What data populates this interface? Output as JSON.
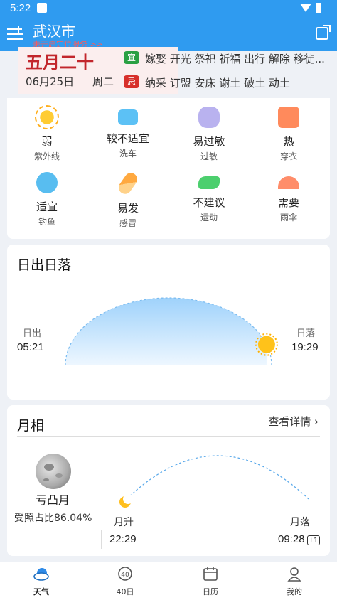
{
  "status": {
    "time": "5:22"
  },
  "header": {
    "city": "武汉市",
    "subtitle": "未开启定位服务 >>"
  },
  "almanac": {
    "lunar_date": "五月二十",
    "solar_date": "06月25日",
    "weekday": "周二",
    "yi_tag": "宜",
    "yi_text": "嫁娶 开光 祭祀 祈福 出行 解除 移徙...",
    "ji_tag": "忌",
    "ji_text": "纳采 订盟 安床 谢土 破土 动土"
  },
  "life_index": [
    {
      "value": "弱",
      "label": "紫外线",
      "icon": "sun-icon"
    },
    {
      "value": "较不适宜",
      "label": "洗车",
      "icon": "car-icon"
    },
    {
      "value": "易过敏",
      "label": "过敏",
      "icon": "mask-icon"
    },
    {
      "value": "热",
      "label": "穿衣",
      "icon": "shirt-icon"
    },
    {
      "value": "适宜",
      "label": "钓鱼",
      "icon": "fish-icon"
    },
    {
      "value": "易发",
      "label": "感冒",
      "icon": "pill-icon"
    },
    {
      "value": "不建议",
      "label": "运动",
      "icon": "shoe-icon"
    },
    {
      "value": "需要",
      "label": "雨伞",
      "icon": "umbrella-icon"
    }
  ],
  "sun": {
    "title": "日出日落",
    "sunrise_label": "日出",
    "sunrise_time": "05:21",
    "sunset_label": "日落",
    "sunset_time": "19:29",
    "progress": 0.9
  },
  "moon": {
    "title": "月相",
    "detail_link": "查看详情 ›",
    "phase": "亏凸月",
    "illumination": "受照占比86.04%",
    "moonrise_label": "月升",
    "moonrise_time": "22:29",
    "moonset_label": "月落",
    "moonset_time": "09:28",
    "moonset_badge": "+1"
  },
  "nav": [
    {
      "label": "天气",
      "icon": "weather-icon",
      "active": true
    },
    {
      "label": "40日",
      "icon": "forty-day-icon",
      "active": false
    },
    {
      "label": "日历",
      "icon": "calendar-icon",
      "active": false
    },
    {
      "label": "我的",
      "icon": "profile-icon",
      "active": false
    }
  ],
  "colors": {
    "header": "#2f9bf0",
    "yi": "#2aa043",
    "ji": "#d7302b",
    "lunar": "#c2262c"
  }
}
